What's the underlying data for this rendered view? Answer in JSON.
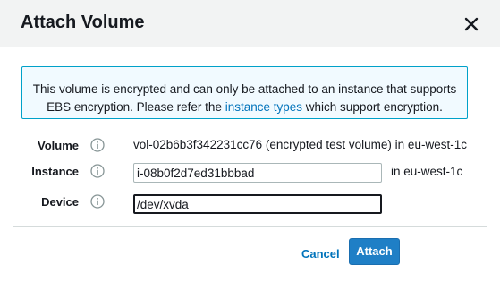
{
  "dialog": {
    "title": "Attach Volume",
    "close_icon": "close-icon"
  },
  "notice": {
    "line1": "This volume is encrypted and can only be attached to an instance that supports",
    "line2_prefix": "EBS encryption. Please refer the",
    "link_text": "instance types",
    "line2_suffix": "which support encryption.",
    "border_color": "#00a1c9",
    "background_color": "#f1faff"
  },
  "form": {
    "volume": {
      "label": "Volume",
      "info_icon": "info-icon",
      "value": "vol-02b6b3f342231cc76 (encrypted test volume) in eu-west-1c"
    },
    "instance": {
      "label": "Instance",
      "info_icon": "info-icon",
      "value": "i-08b0f2d7ed31bbbad",
      "region_suffix": "in eu-west-1c"
    },
    "device": {
      "label": "Device",
      "info_icon": "info-icon",
      "value": "/dev/xvda"
    }
  },
  "footer": {
    "cancel_label": "Cancel",
    "attach_label": "Attach",
    "primary_color": "#1f7fc6",
    "link_color": "#0073bb"
  }
}
